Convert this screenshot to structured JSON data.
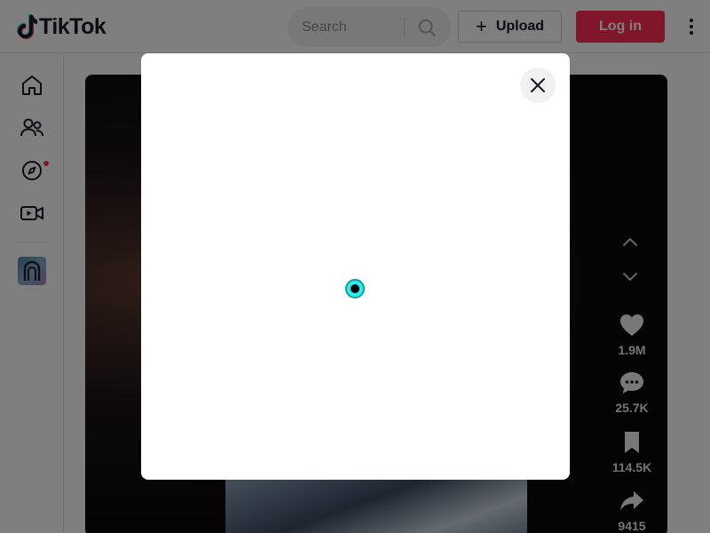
{
  "header": {
    "logo_text": "TikTok",
    "search_placeholder": "Search",
    "upload_label": "Upload",
    "login_label": "Log in"
  },
  "sidebar": {
    "items": [
      {
        "name": "home",
        "icon": "home-icon"
      },
      {
        "name": "following",
        "icon": "users-icon"
      },
      {
        "name": "explore",
        "icon": "compass-icon",
        "notification_dot": true
      },
      {
        "name": "live",
        "icon": "live-video-icon"
      }
    ]
  },
  "video": {
    "actions": {
      "likes": "1.9M",
      "comments": "25.7K",
      "saves": "114.5K",
      "shares": "9415"
    }
  },
  "modal": {
    "state": "loading"
  },
  "colors": {
    "brand_red": "#fe2c55",
    "spinner_cyan": "#25f4ee",
    "text_dark": "#161823"
  }
}
